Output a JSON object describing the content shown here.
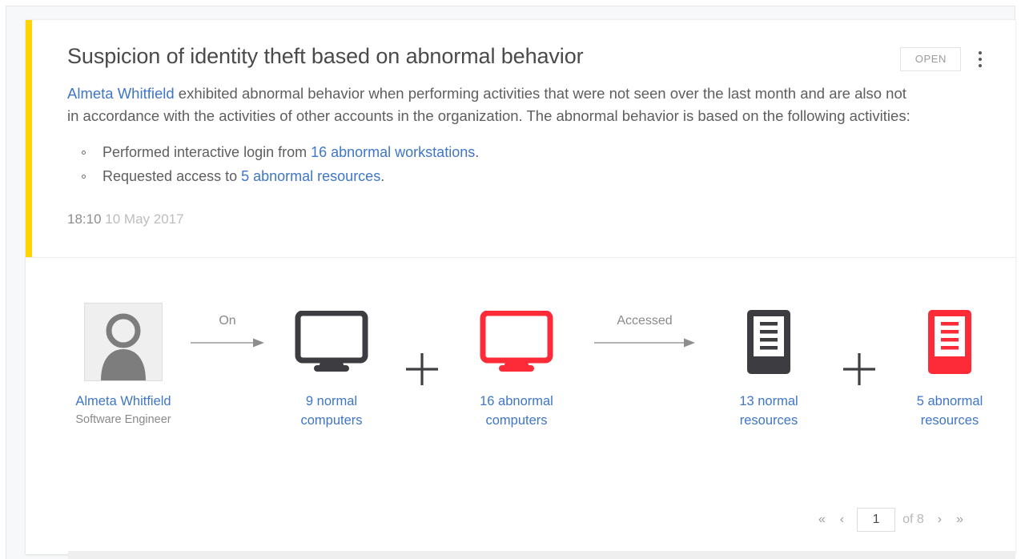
{
  "card": {
    "accent_color": "#ffd400",
    "title": "Suspicion of identity theft based on abnormal behavior",
    "open_label": "OPEN",
    "menu_icon": "kebab-menu-icon",
    "paragraph": {
      "subject_link": "Almeta Whitfield",
      "rest": " exhibited abnormal behavior when performing activities that were not seen over the last month and are also not in accordance with the activities of other accounts in the organization. The abnormal behavior is based on the following activities:"
    },
    "bullets": [
      {
        "prefix": "Performed interactive login from ",
        "link": "16 abnormal workstations",
        "suffix": "."
      },
      {
        "prefix": "Requested access to ",
        "link": "5 abnormal resources",
        "suffix": "."
      }
    ],
    "timestamp": {
      "time": "18:10",
      "date": "10 May 2017"
    }
  },
  "diagram": {
    "actor": {
      "icon": "user-avatar-icon",
      "name": "Almeta Whitfield",
      "role": "Software Engineer"
    },
    "connector_1": {
      "label": "On",
      "icon": "arrow-right-icon"
    },
    "connector_2": {
      "label": "Accessed",
      "icon": "arrow-right-icon"
    },
    "plus_symbol": "+",
    "nodes": [
      {
        "icon": "monitor-icon",
        "color": "#3c3c41",
        "count": 9,
        "label_line1": "9 normal",
        "label_line2": "computers"
      },
      {
        "icon": "monitor-icon",
        "color": "#fc2b37",
        "count": 16,
        "label_line1": "16 abnormal",
        "label_line2": "computers"
      },
      {
        "icon": "resource-icon",
        "color": "#3c3c41",
        "count": 13,
        "label_line1": "13 normal",
        "label_line2": "resources"
      },
      {
        "icon": "resource-icon",
        "color": "#fc2b37",
        "count": 5,
        "label_line1": "5 abnormal",
        "label_line2": "resources"
      }
    ]
  },
  "pagination": {
    "first_label": "«",
    "prev_label": "‹",
    "page_value": "1",
    "of_label": "of 8",
    "next_label": "›",
    "last_label": "»"
  },
  "colors": {
    "accent_yellow": "#ffd400",
    "link_blue": "#3f76c7",
    "alert_red": "#fc2b37",
    "icon_dark": "#3c3c41",
    "text_gray": "#5e5e5e"
  }
}
